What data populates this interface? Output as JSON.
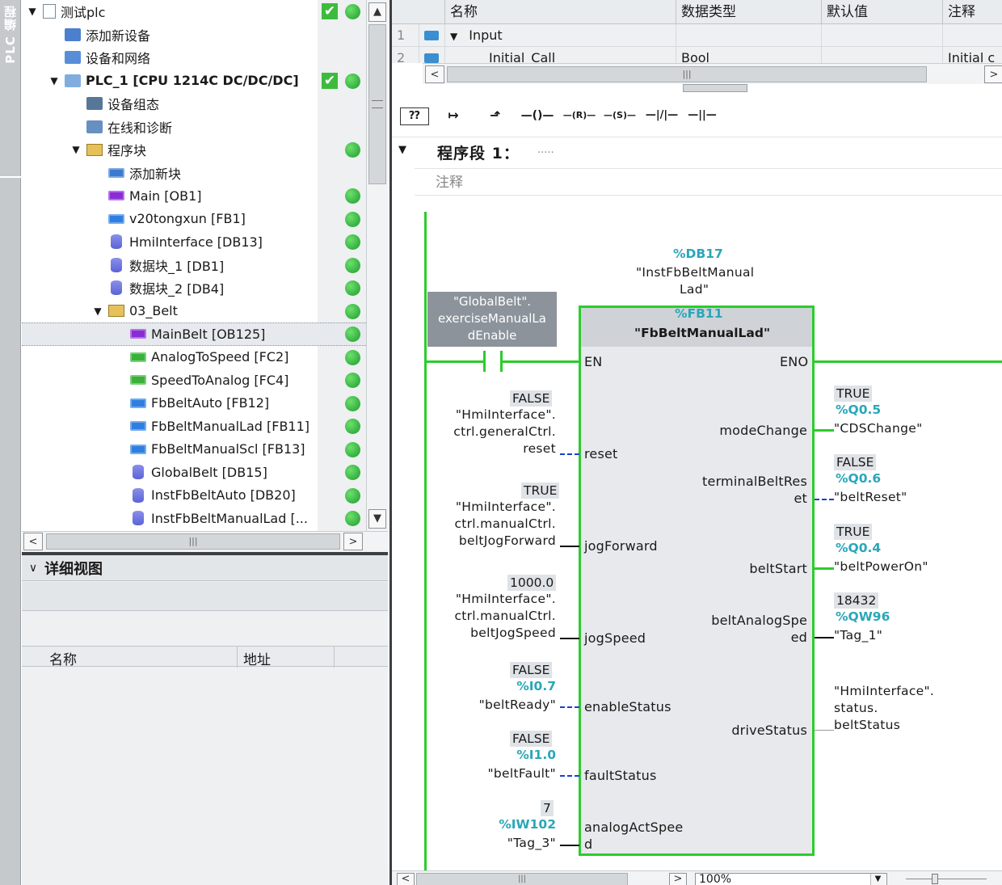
{
  "side_tab": "PLC 编程",
  "tree": {
    "items": [
      {
        "label": "测试plc",
        "indent": 0,
        "exp": "▼",
        "icon": "project-icon",
        "chk": true,
        "dot": true
      },
      {
        "label": "添加新设备",
        "indent": 1,
        "exp": "",
        "icon": "add-device-icon"
      },
      {
        "label": "设备和网络",
        "indent": 1,
        "exp": "",
        "icon": "network-icon"
      },
      {
        "label": "PLC_1 [CPU 1214C DC/DC/DC]",
        "indent": 1,
        "exp": "▼",
        "icon": "cpu-icon",
        "chk": true,
        "dot": true,
        "bold": true
      },
      {
        "label": "设备组态",
        "indent": 2,
        "exp": "",
        "icon": "device-config-icon"
      },
      {
        "label": "在线和诊断",
        "indent": 2,
        "exp": "",
        "icon": "online-diag-icon"
      },
      {
        "label": "程序块",
        "indent": 2,
        "exp": "▼",
        "icon": "folder-icon",
        "dot": true
      },
      {
        "label": "添加新块",
        "indent": 3,
        "exp": "",
        "icon": "add-block-icon"
      },
      {
        "label": "Main [OB1]",
        "indent": 3,
        "exp": "",
        "icon": "ob-block-icon",
        "dot": true
      },
      {
        "label": "v20tongxun [FB1]",
        "indent": 3,
        "exp": "",
        "icon": "fb-block-icon",
        "dot": true
      },
      {
        "label": "HmiInterface [DB13]",
        "indent": 3,
        "exp": "",
        "icon": "db-icon",
        "dot": true
      },
      {
        "label": "数据块_1 [DB1]",
        "indent": 3,
        "exp": "",
        "icon": "db-icon",
        "dot": true
      },
      {
        "label": "数据块_2 [DB4]",
        "indent": 3,
        "exp": "",
        "icon": "db-icon",
        "dot": true
      },
      {
        "label": "03_Belt",
        "indent": 3,
        "exp": "▼",
        "icon": "folder-icon",
        "dot": true
      },
      {
        "label": "MainBelt [OB125]",
        "indent": 4,
        "exp": "",
        "icon": "ob-block-icon",
        "dot": true,
        "selected": true
      },
      {
        "label": "AnalogToSpeed [FC2]",
        "indent": 4,
        "exp": "",
        "icon": "fc-block-icon",
        "dot": true
      },
      {
        "label": "SpeedToAnalog [FC4]",
        "indent": 4,
        "exp": "",
        "icon": "fc-block-icon",
        "dot": true
      },
      {
        "label": "FbBeltAuto [FB12]",
        "indent": 4,
        "exp": "",
        "icon": "fb-block-icon",
        "dot": true
      },
      {
        "label": "FbBeltManualLad [FB11]",
        "indent": 4,
        "exp": "",
        "icon": "fb-block-icon",
        "dot": true
      },
      {
        "label": "FbBeltManualScl [FB13]",
        "indent": 4,
        "exp": "",
        "icon": "fb-block-icon",
        "dot": true
      },
      {
        "label": "GlobalBelt [DB15]",
        "indent": 4,
        "exp": "",
        "icon": "db-icon",
        "dot": true
      },
      {
        "label": "InstFbBeltAuto [DB20]",
        "indent": 4,
        "exp": "",
        "icon": "db-icon",
        "dot": true
      },
      {
        "label": "InstFbBeltManualLad [...",
        "indent": 4,
        "exp": "",
        "icon": "db-icon",
        "dot": true
      }
    ]
  },
  "detail": {
    "title": "详细视图",
    "col_name": "名称",
    "col_addr": "地址"
  },
  "iface": {
    "headers": [
      "名称",
      "数据类型",
      "默认值",
      "注释"
    ],
    "rows": [
      {
        "num": "1",
        "name": "Input",
        "type": "",
        "default": "",
        "comment": ""
      },
      {
        "num": "2",
        "name": "Initial_Call",
        "type": "Bool",
        "default": "",
        "comment": "Initial c"
      }
    ]
  },
  "toolbar": [
    "⁇",
    "↦",
    "⬏",
    "—()—",
    "—(R)—",
    "—(S)—",
    "—|/|—",
    "—||—"
  ],
  "network": {
    "title": "程序段 1：",
    "dots": ".....",
    "comment": "注释"
  },
  "block": {
    "instance_addr": "%DB17",
    "instance_name": "\"InstFbBeltManual",
    "instance_name2": "Lad\"",
    "fb_addr": "%FB11",
    "fb_name": "\"FbBeltManualLad\"",
    "contact_label": "\"GlobalBelt\".",
    "contact_label2": "exerciseManualLa",
    "contact_label3": "dEnable",
    "en": "EN",
    "eno": "ENO",
    "inputs": [
      {
        "pin": "reset",
        "val": "FALSE",
        "l1": "\"HmiInterface\".",
        "l2": "ctrl.generalCtrl.",
        "l3": "reset"
      },
      {
        "pin": "jogForward",
        "val": "TRUE",
        "l1": "\"HmiInterface\".",
        "l2": "ctrl.manualCtrl.",
        "l3": "beltJogForward"
      },
      {
        "pin": "jogSpeed",
        "val": "1000.0",
        "l1": "\"HmiInterface\".",
        "l2": "ctrl.manualCtrl.",
        "l3": "beltJogSpeed"
      },
      {
        "pin": "enableStatus",
        "val": "FALSE",
        "addr": "%I0.7",
        "l3": "\"beltReady\""
      },
      {
        "pin": "faultStatus",
        "val": "FALSE",
        "addr": "%I1.0",
        "l3": "\"beltFault\""
      },
      {
        "pin": "analogActSpee",
        "pin2": "d",
        "val": "7",
        "addr": "%IW102",
        "l3": "\"Tag_3\""
      }
    ],
    "outputs": [
      {
        "pin": "modeChange",
        "val": "TRUE",
        "addr": "%Q0.5",
        "name": "\"CDSChange\""
      },
      {
        "pin": "terminalBeltRes",
        "pin2": "et",
        "val": "FALSE",
        "addr": "%Q0.6",
        "name": "\"beltReset\""
      },
      {
        "pin": "beltStart",
        "val": "TRUE",
        "addr": "%Q0.4",
        "name": "\"beltPowerOn\""
      },
      {
        "pin": "beltAnalogSpe",
        "pin2": "ed",
        "val": "18432",
        "addr": "%QW96",
        "name": "\"Tag_1\""
      },
      {
        "pin": "driveStatus",
        "n1": "\"HmiInterface\".",
        "n2": "status.",
        "n3": "beltStatus"
      }
    ]
  },
  "zoom": "100%"
}
